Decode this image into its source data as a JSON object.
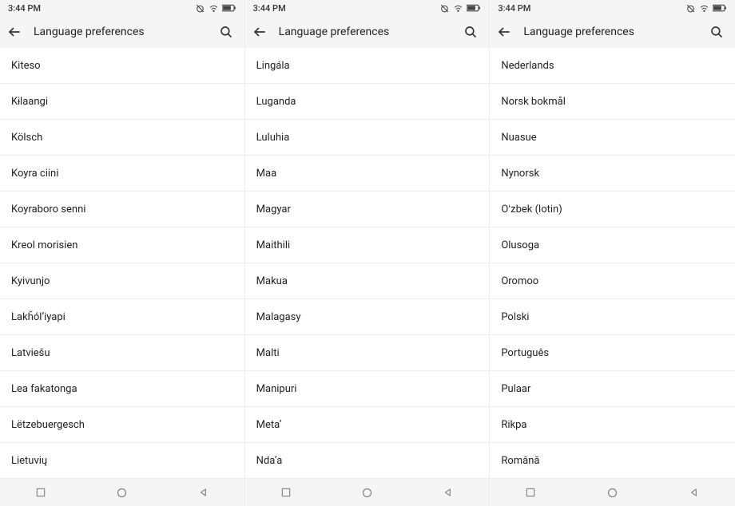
{
  "status": {
    "time": "3:44 PM"
  },
  "header": {
    "title": "Language preferences"
  },
  "screens": [
    {
      "items": [
        "Kiteso",
        "Kɨlaangi",
        "Kölsch",
        "Koyra ciini",
        "Koyraboro senni",
        "Kreol morisien",
        "Kyivunjo",
        "Lakȟólʼiyapi",
        "Latviešu",
        "Lea fakatonga",
        "Lëtzebuergesch",
        "Lietuvių"
      ]
    },
    {
      "items": [
        "Lingála",
        "Luganda",
        "Luluhia",
        "Maa",
        "Magyar",
        "Maithili",
        "Makua",
        "Malagasy",
        "Malti",
        "Manipuri",
        "Metaʼ",
        "Ndaʼa"
      ]
    },
    {
      "items": [
        "Nederlands",
        "Norsk bokmål",
        "Nuasue",
        "Nynorsk",
        "Oʻzbek (lotin)",
        "Olusoga",
        "Oromoo",
        "Polski",
        "Português",
        "Pulaar",
        "Rikpa",
        "Română"
      ]
    }
  ]
}
